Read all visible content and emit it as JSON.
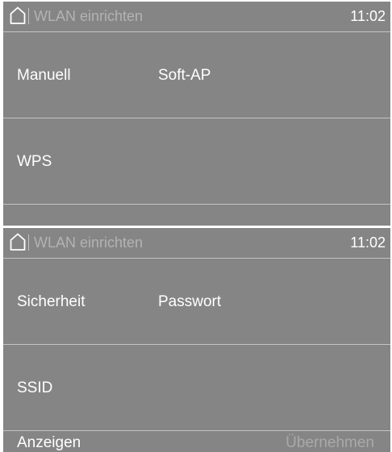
{
  "screen1": {
    "header": {
      "title": "WLAN einrichten",
      "time": "11:02",
      "icon": "home-icon"
    },
    "rows": [
      [
        "Manuell",
        "Soft-AP"
      ],
      [
        "WPS"
      ]
    ]
  },
  "screen2": {
    "header": {
      "title": "WLAN einrichten",
      "time": "11:02",
      "icon": "home-icon"
    },
    "rows": [
      [
        "Sicherheit",
        "Passwort"
      ],
      [
        "SSID"
      ]
    ],
    "footer": {
      "left": "Anzeigen",
      "right": "Übernehmen"
    }
  },
  "colors": {
    "screen_bg": "#858585",
    "divider": "#c4c4c4",
    "text": "#ffffff",
    "muted_text": "#b3b3b3",
    "disabled_text": "#a9a9a9"
  }
}
